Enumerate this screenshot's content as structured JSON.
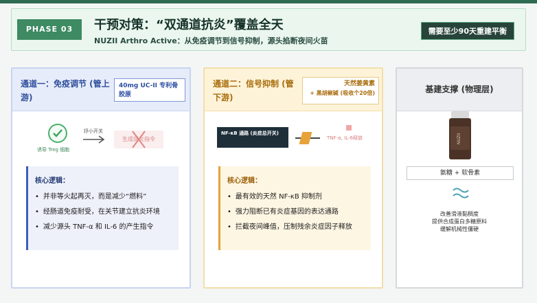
{
  "header": {
    "phase": "PHASE 03",
    "title": "干预对策：“双通道抗炎”覆盖全天",
    "subtitle": "NUZII Arthro Active：从免疫调节到信号抑制，源头掐断夜间火苗",
    "badge": "需要至少90天重建平衡"
  },
  "panel1": {
    "title": "通道一：免疫调节 (管上游)",
    "tag": "40mg UC-II 专利骨胶原",
    "treg_label": "诱导 Treg 细胞",
    "arrow_label": "抒小开关",
    "fuel_label": "生成促炎指令",
    "logic_title": "核心逻辑：",
    "logic_items": [
      "并非等火起再灭，而是减少“燃料”",
      "经肠道免疫耐受，在关节建立抗炎环境",
      "减少源头 TNF-α 和 IL-6 的产生指令"
    ]
  },
  "panel2": {
    "title": "通道二：信号抑制 (管下游)",
    "tag_line1": "天然姜黄素",
    "tag_line2": "+ 黑胡椒碱 (吸收个20倍)",
    "nfkb_label": "NF-κB 通路 (炎症总开关)",
    "tnf_label": "TNF-α, IL-6释放",
    "logic_title": "核心逻辑：",
    "logic_items": [
      "最有效的天然 NF-κB 抑制剂",
      "强力阻断已有炎症基因的表达通路",
      "拦截夜间峰值，压制残余炎症因子释放"
    ]
  },
  "panel3": {
    "title": "基建支撑 (物理层)",
    "bottle_brand": "NUZII",
    "supplement": "氨糖 + 软骨素",
    "desc_lines": [
      "改善滑液黏稠度",
      "提供合成蛋白多糖原料",
      "缓解机械性僵硬"
    ]
  },
  "colors": {
    "topbar": "#2f6b52",
    "phase_badge": "#3d8a63",
    "channel1_accent": "#3b5db8",
    "channel2_accent": "#e3a33c"
  }
}
